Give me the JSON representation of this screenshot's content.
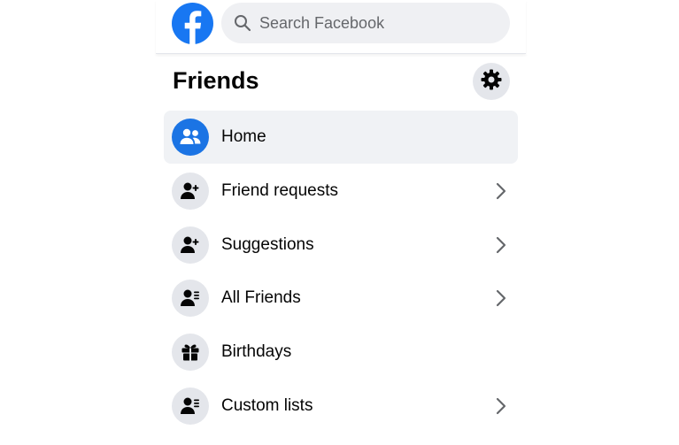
{
  "header": {
    "search_placeholder": "Search Facebook"
  },
  "sidebar": {
    "title": "Friends",
    "items": [
      {
        "label": "Home",
        "icon": "friends-icon",
        "active": true,
        "has_chevron": false
      },
      {
        "label": "Friend requests",
        "icon": "person-add-icon",
        "active": false,
        "has_chevron": true
      },
      {
        "label": "Suggestions",
        "icon": "person-add-icon",
        "active": false,
        "has_chevron": true
      },
      {
        "label": "All Friends",
        "icon": "person-list-icon",
        "active": false,
        "has_chevron": true
      },
      {
        "label": "Birthdays",
        "icon": "gift-icon",
        "active": false,
        "has_chevron": false
      },
      {
        "label": "Custom lists",
        "icon": "person-list-icon",
        "active": false,
        "has_chevron": true
      }
    ]
  },
  "colors": {
    "brand": "#1877f2",
    "active_bg": "#f0f2f5",
    "icon_bg": "#e4e6eb"
  }
}
